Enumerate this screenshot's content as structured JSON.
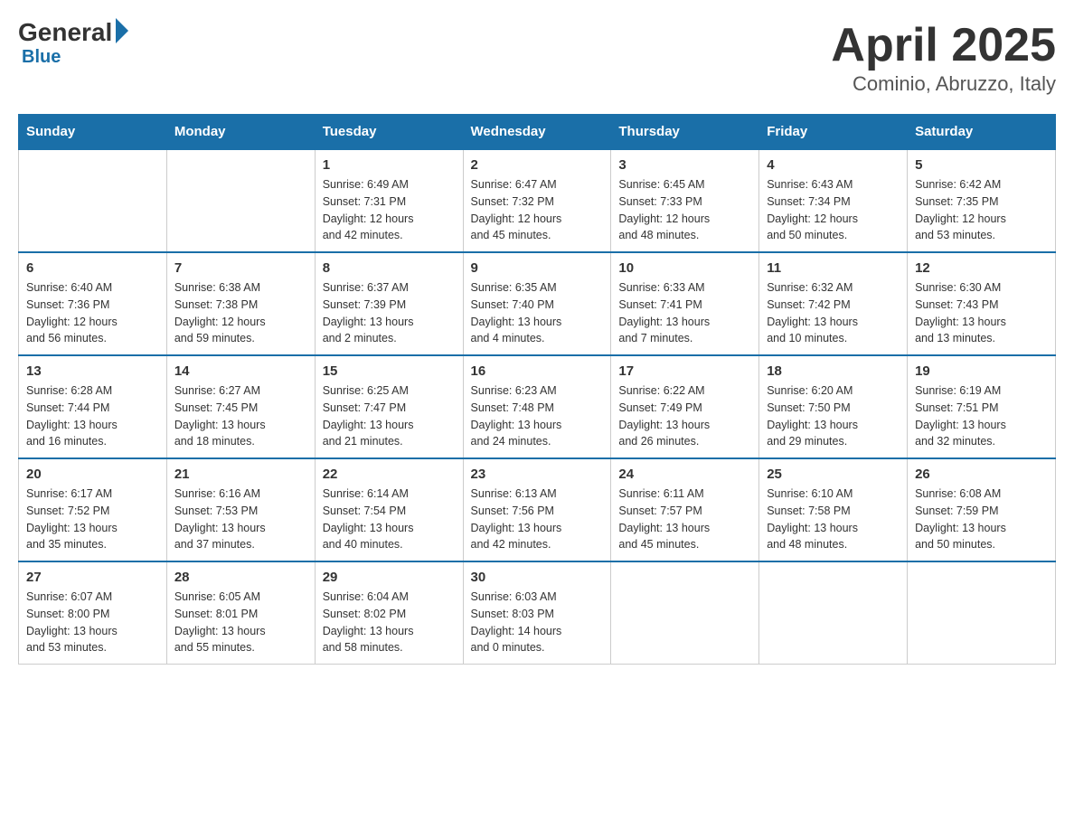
{
  "logo": {
    "general": "General",
    "blue": "Blue"
  },
  "title": "April 2025",
  "subtitle": "Cominio, Abruzzo, Italy",
  "days_of_week": [
    "Sunday",
    "Monday",
    "Tuesday",
    "Wednesday",
    "Thursday",
    "Friday",
    "Saturday"
  ],
  "weeks": [
    [
      {
        "day": "",
        "info": ""
      },
      {
        "day": "",
        "info": ""
      },
      {
        "day": "1",
        "info": "Sunrise: 6:49 AM\nSunset: 7:31 PM\nDaylight: 12 hours\nand 42 minutes."
      },
      {
        "day": "2",
        "info": "Sunrise: 6:47 AM\nSunset: 7:32 PM\nDaylight: 12 hours\nand 45 minutes."
      },
      {
        "day": "3",
        "info": "Sunrise: 6:45 AM\nSunset: 7:33 PM\nDaylight: 12 hours\nand 48 minutes."
      },
      {
        "day": "4",
        "info": "Sunrise: 6:43 AM\nSunset: 7:34 PM\nDaylight: 12 hours\nand 50 minutes."
      },
      {
        "day": "5",
        "info": "Sunrise: 6:42 AM\nSunset: 7:35 PM\nDaylight: 12 hours\nand 53 minutes."
      }
    ],
    [
      {
        "day": "6",
        "info": "Sunrise: 6:40 AM\nSunset: 7:36 PM\nDaylight: 12 hours\nand 56 minutes."
      },
      {
        "day": "7",
        "info": "Sunrise: 6:38 AM\nSunset: 7:38 PM\nDaylight: 12 hours\nand 59 minutes."
      },
      {
        "day": "8",
        "info": "Sunrise: 6:37 AM\nSunset: 7:39 PM\nDaylight: 13 hours\nand 2 minutes."
      },
      {
        "day": "9",
        "info": "Sunrise: 6:35 AM\nSunset: 7:40 PM\nDaylight: 13 hours\nand 4 minutes."
      },
      {
        "day": "10",
        "info": "Sunrise: 6:33 AM\nSunset: 7:41 PM\nDaylight: 13 hours\nand 7 minutes."
      },
      {
        "day": "11",
        "info": "Sunrise: 6:32 AM\nSunset: 7:42 PM\nDaylight: 13 hours\nand 10 minutes."
      },
      {
        "day": "12",
        "info": "Sunrise: 6:30 AM\nSunset: 7:43 PM\nDaylight: 13 hours\nand 13 minutes."
      }
    ],
    [
      {
        "day": "13",
        "info": "Sunrise: 6:28 AM\nSunset: 7:44 PM\nDaylight: 13 hours\nand 16 minutes."
      },
      {
        "day": "14",
        "info": "Sunrise: 6:27 AM\nSunset: 7:45 PM\nDaylight: 13 hours\nand 18 minutes."
      },
      {
        "day": "15",
        "info": "Sunrise: 6:25 AM\nSunset: 7:47 PM\nDaylight: 13 hours\nand 21 minutes."
      },
      {
        "day": "16",
        "info": "Sunrise: 6:23 AM\nSunset: 7:48 PM\nDaylight: 13 hours\nand 24 minutes."
      },
      {
        "day": "17",
        "info": "Sunrise: 6:22 AM\nSunset: 7:49 PM\nDaylight: 13 hours\nand 26 minutes."
      },
      {
        "day": "18",
        "info": "Sunrise: 6:20 AM\nSunset: 7:50 PM\nDaylight: 13 hours\nand 29 minutes."
      },
      {
        "day": "19",
        "info": "Sunrise: 6:19 AM\nSunset: 7:51 PM\nDaylight: 13 hours\nand 32 minutes."
      }
    ],
    [
      {
        "day": "20",
        "info": "Sunrise: 6:17 AM\nSunset: 7:52 PM\nDaylight: 13 hours\nand 35 minutes."
      },
      {
        "day": "21",
        "info": "Sunrise: 6:16 AM\nSunset: 7:53 PM\nDaylight: 13 hours\nand 37 minutes."
      },
      {
        "day": "22",
        "info": "Sunrise: 6:14 AM\nSunset: 7:54 PM\nDaylight: 13 hours\nand 40 minutes."
      },
      {
        "day": "23",
        "info": "Sunrise: 6:13 AM\nSunset: 7:56 PM\nDaylight: 13 hours\nand 42 minutes."
      },
      {
        "day": "24",
        "info": "Sunrise: 6:11 AM\nSunset: 7:57 PM\nDaylight: 13 hours\nand 45 minutes."
      },
      {
        "day": "25",
        "info": "Sunrise: 6:10 AM\nSunset: 7:58 PM\nDaylight: 13 hours\nand 48 minutes."
      },
      {
        "day": "26",
        "info": "Sunrise: 6:08 AM\nSunset: 7:59 PM\nDaylight: 13 hours\nand 50 minutes."
      }
    ],
    [
      {
        "day": "27",
        "info": "Sunrise: 6:07 AM\nSunset: 8:00 PM\nDaylight: 13 hours\nand 53 minutes."
      },
      {
        "day": "28",
        "info": "Sunrise: 6:05 AM\nSunset: 8:01 PM\nDaylight: 13 hours\nand 55 minutes."
      },
      {
        "day": "29",
        "info": "Sunrise: 6:04 AM\nSunset: 8:02 PM\nDaylight: 13 hours\nand 58 minutes."
      },
      {
        "day": "30",
        "info": "Sunrise: 6:03 AM\nSunset: 8:03 PM\nDaylight: 14 hours\nand 0 minutes."
      },
      {
        "day": "",
        "info": ""
      },
      {
        "day": "",
        "info": ""
      },
      {
        "day": "",
        "info": ""
      }
    ]
  ]
}
